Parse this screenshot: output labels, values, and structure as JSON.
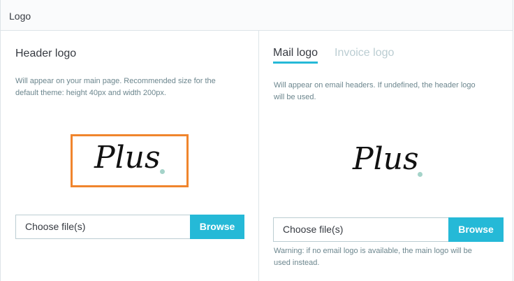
{
  "panel": {
    "title": "Logo"
  },
  "header_logo": {
    "heading": "Header logo",
    "help_line1": "Will appear on your main page. Recommended size for the",
    "help_line2": "default theme: height 40px and width 200px.",
    "logo_text": "Plus",
    "file_placeholder": "Choose file(s)",
    "browse_label": "Browse",
    "highlight_color": "#f0852d"
  },
  "mail_logo": {
    "tabs": [
      {
        "label": "Mail logo",
        "active": true
      },
      {
        "label": "Invoice logo",
        "active": false
      }
    ],
    "help_line1": "Will appear on email headers. If undefined, the header logo",
    "help_line2": "will be used.",
    "logo_text": "Plus",
    "file_placeholder": "Choose file(s)",
    "browse_label": "Browse",
    "warning_line1": "Warning: if no email logo is available, the main logo will be",
    "warning_line2": "used instead."
  },
  "colors": {
    "accent": "#25b9d7",
    "logo_dot": "#a4d3c9",
    "muted_text": "#6c868e"
  }
}
